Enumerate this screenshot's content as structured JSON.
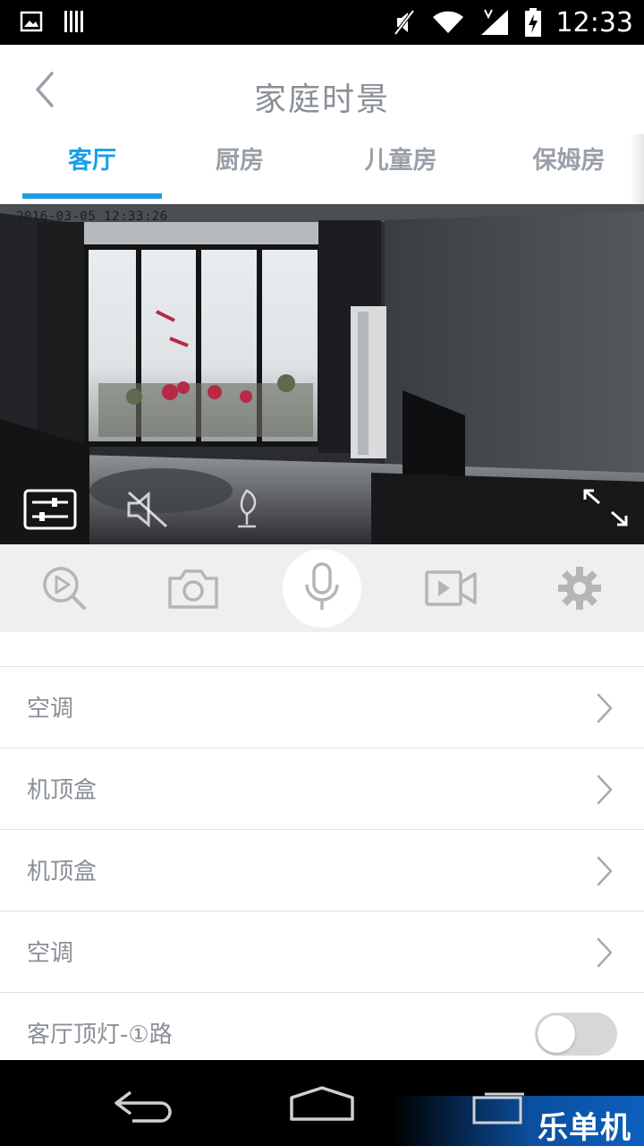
{
  "status_bar": {
    "time": "12:33",
    "left_icons": [
      "image-notification-icon",
      "barcode-notification-icon"
    ],
    "right_icons": [
      "mute-icon",
      "wifi-icon",
      "signal-icon",
      "battery-charging-icon"
    ]
  },
  "header": {
    "title": "家庭时景",
    "back_icon": "chevron-left-icon"
  },
  "tabs": [
    {
      "label": "客厅",
      "active": true
    },
    {
      "label": "厨房",
      "active": false
    },
    {
      "label": "儿童房",
      "active": false
    },
    {
      "label": "保姆房",
      "active": false
    }
  ],
  "video": {
    "timestamp": "2016-03-05 12:33:26",
    "controls": [
      "settings-sliders-icon",
      "speaker-mute-icon",
      "quality-icon",
      "fullscreen-expand-icon"
    ]
  },
  "toolbar": {
    "buttons": [
      "playback-search-icon",
      "camera-icon",
      "microphone-icon",
      "video-record-icon",
      "settings-gear-icon"
    ]
  },
  "devices": [
    {
      "label": "空调",
      "control": "chevron"
    },
    {
      "label": "机顶盒",
      "control": "chevron"
    },
    {
      "label": "机顶盒",
      "control": "chevron"
    },
    {
      "label": "空调",
      "control": "chevron"
    },
    {
      "label": "客厅顶灯-①路",
      "control": "toggle",
      "on": false
    }
  ],
  "colors": {
    "accent": "#1a9ee8",
    "text_gray": "#8a8f96",
    "toolbar_bg": "#efefef",
    "divider": "#e2e2e2"
  },
  "watermark": {
    "text": "乐单机"
  }
}
